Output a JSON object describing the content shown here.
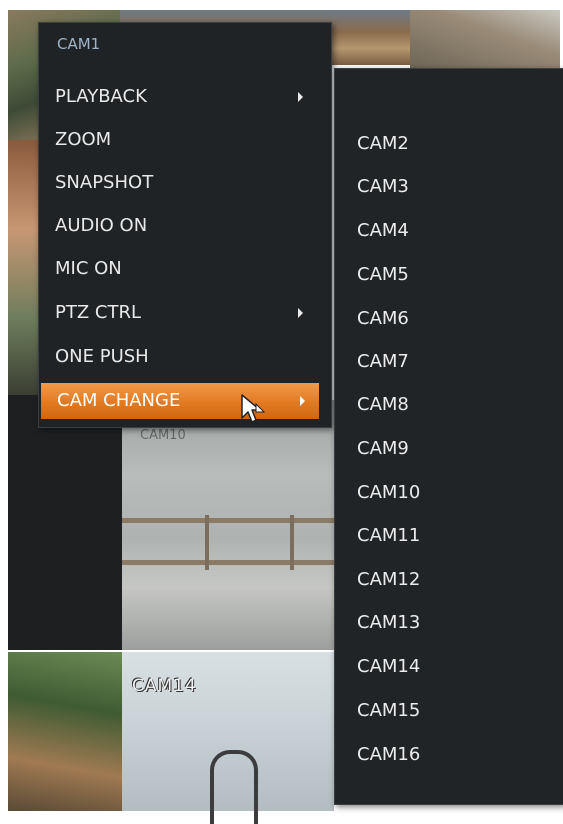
{
  "background": {
    "tiles": [
      {
        "label": ""
      },
      {
        "label": "CAM14"
      }
    ],
    "partial_label": "CAM10"
  },
  "context_menu": {
    "title": "CAM1",
    "items": [
      {
        "label": "PLAYBACK",
        "has_submenu": true
      },
      {
        "label": "ZOOM",
        "has_submenu": false
      },
      {
        "label": "SNAPSHOT",
        "has_submenu": false
      },
      {
        "label": "AUDIO ON",
        "has_submenu": false
      },
      {
        "label": "MIC ON",
        "has_submenu": false
      },
      {
        "label": "PTZ CTRL",
        "has_submenu": true
      },
      {
        "label": "ONE PUSH",
        "has_submenu": false
      },
      {
        "label": "CAM CHANGE",
        "has_submenu": true,
        "active": true
      }
    ],
    "highlight_color": "#e27a22"
  },
  "submenu": {
    "items": [
      "CAM2",
      "CAM3",
      "CAM4",
      "CAM5",
      "CAM6",
      "CAM7",
      "CAM8",
      "CAM9",
      "CAM10",
      "CAM11",
      "CAM12",
      "CAM13",
      "CAM14",
      "CAM15",
      "CAM16"
    ]
  },
  "icons": {
    "cursor": "mouse-pointer-icon",
    "submenu_arrow": "chevron-right-icon"
  }
}
